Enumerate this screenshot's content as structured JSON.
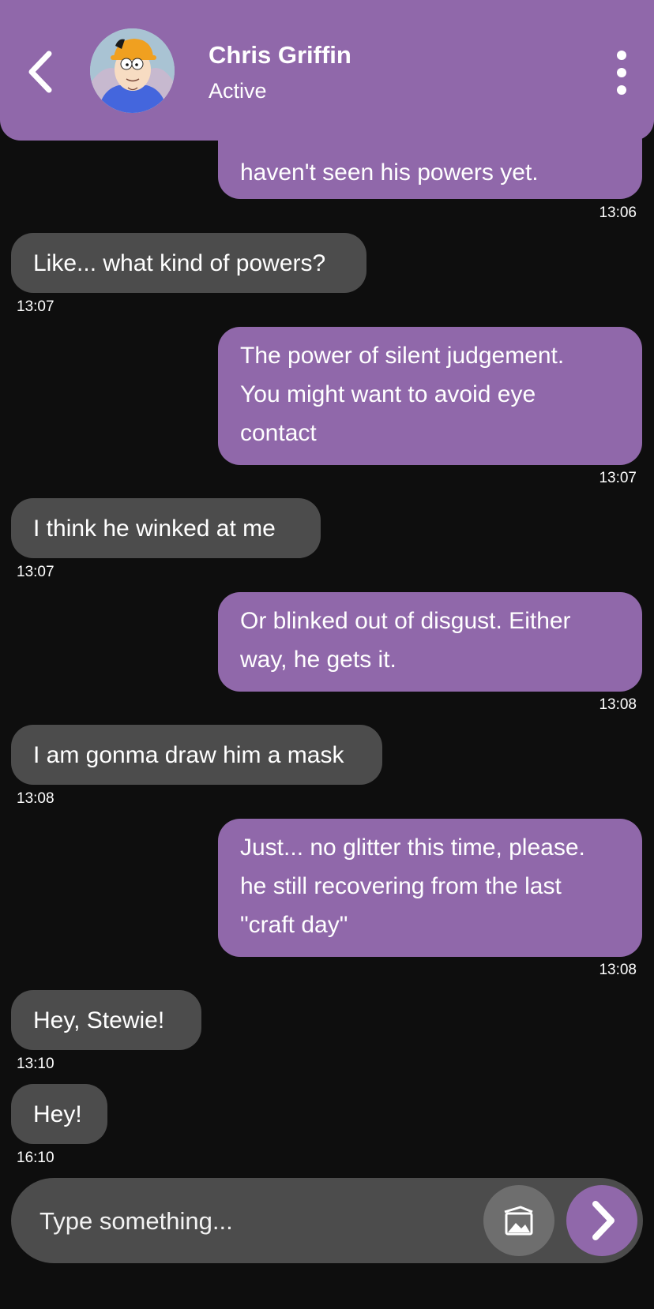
{
  "header": {
    "name": "Chris Griffin",
    "status": "Active",
    "accent_color": "#9068aa",
    "icons": {
      "back": "chevron-left-icon",
      "menu": "more-vertical-icon"
    }
  },
  "messages": [
    {
      "direction": "sent",
      "lines": [
        "haven't seen his powers yet."
      ],
      "time": "13:06"
    },
    {
      "direction": "received",
      "lines": [
        "Like... what kind of powers?"
      ],
      "time": "13:07"
    },
    {
      "direction": "sent",
      "lines": [
        "The power of silent judgement.",
        "You might want to avoid eye",
        "contact"
      ],
      "time": "13:07"
    },
    {
      "direction": "received",
      "lines": [
        "I think he winked at me"
      ],
      "time": "13:07"
    },
    {
      "direction": "sent",
      "lines": [
        "Or blinked out of disgust. Either",
        "way, he gets it."
      ],
      "time": "13:08"
    },
    {
      "direction": "received",
      "lines": [
        "I am gonma draw him a mask"
      ],
      "time": "13:08"
    },
    {
      "direction": "sent",
      "lines": [
        "Just... no glitter this time, please.",
        "he still recovering from the last",
        "\"craft day\""
      ],
      "time": "13:08"
    },
    {
      "direction": "received",
      "lines": [
        "Hey, Stewie!"
      ],
      "time": "13:10"
    },
    {
      "direction": "received",
      "lines": [
        "Hey!"
      ],
      "time": "16:10"
    }
  ],
  "composer": {
    "placeholder": "Type something...",
    "icons": {
      "attach": "image-icon",
      "send": "chevron-right-icon"
    }
  }
}
